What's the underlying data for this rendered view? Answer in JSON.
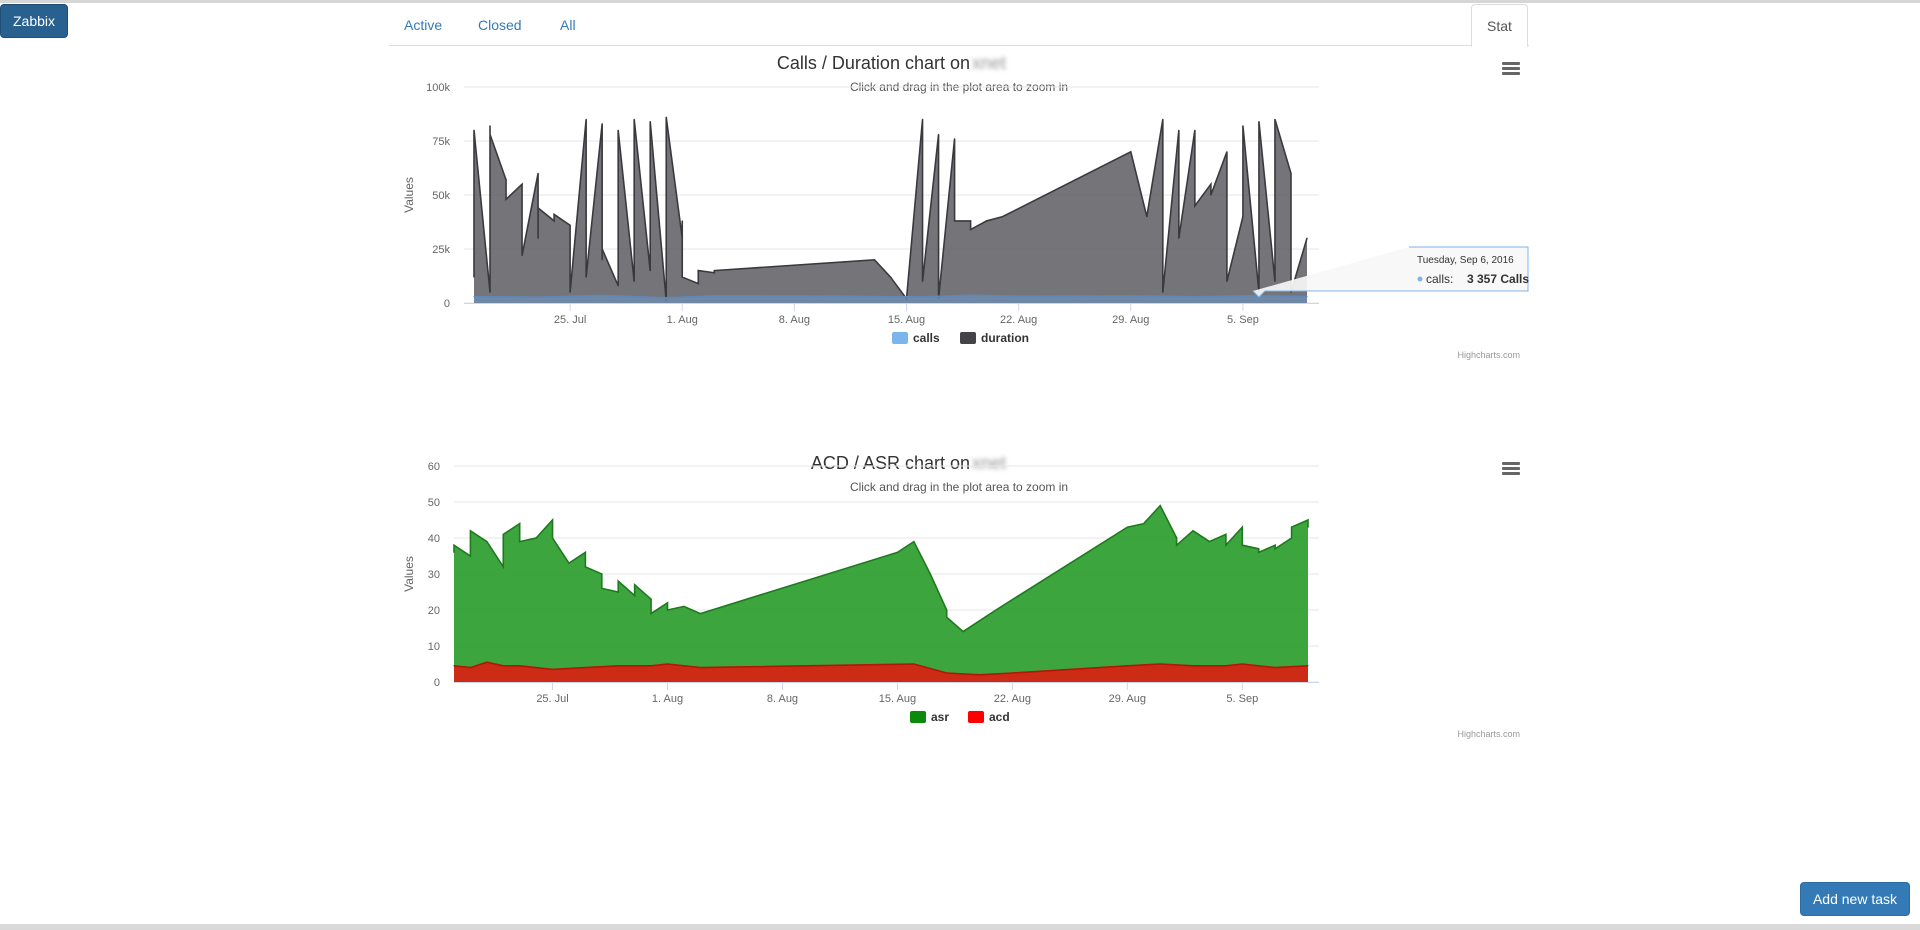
{
  "app": {
    "brand_label": "Zabbix",
    "add_task_label": "Add new task"
  },
  "tabs": [
    {
      "label": "Active",
      "active": false
    },
    {
      "label": "Closed",
      "active": false
    },
    {
      "label": "All",
      "active": false
    },
    {
      "label": "Stat",
      "active": true
    }
  ],
  "charts_meta": {
    "menu_icon": "hamburger-menu-icon",
    "credits": "Highcharts.com"
  },
  "chart_data": [
    {
      "type": "area",
      "title": "Calls / Duration chart on",
      "title_host": "xnet",
      "subtitle": "Click and drag in the plot area to zoom in",
      "ylabel": "Values",
      "ylim": [
        0,
        100000
      ],
      "y_ticks": [
        0,
        25000,
        50000,
        75000,
        100000
      ],
      "y_tick_labels": [
        "0",
        "25k",
        "50k",
        "75k",
        "100k"
      ],
      "x_range": [
        "2016-07-19",
        "2016-09-09"
      ],
      "x_ticks": [
        "2016-07-25",
        "2016-08-01",
        "2016-08-08",
        "2016-08-15",
        "2016-08-22",
        "2016-08-29",
        "2016-09-05"
      ],
      "x_tick_labels": [
        "25. Jul",
        "1. Aug",
        "8. Aug",
        "15. Aug",
        "22. Aug",
        "29. Aug",
        "5. Sep"
      ],
      "grid": true,
      "legend_position": "bottom-center",
      "series": [
        {
          "name": "duration",
          "color": "#434348",
          "x": [
            "2016-07-19",
            "2016-07-19",
            "2016-07-20",
            "2016-07-20",
            "2016-07-20",
            "2016-07-21",
            "2016-07-21",
            "2016-07-22",
            "2016-07-22",
            "2016-07-23",
            "2016-07-23",
            "2016-07-23",
            "2016-07-24",
            "2016-07-24",
            "2016-07-25",
            "2016-07-25",
            "2016-07-26",
            "2016-07-26",
            "2016-07-27",
            "2016-07-27",
            "2016-07-27",
            "2016-07-28",
            "2016-07-28",
            "2016-07-29",
            "2016-07-29",
            "2016-07-30",
            "2016-07-30",
            "2016-07-31",
            "2016-07-31",
            "2016-08-01",
            "2016-08-01",
            "2016-08-01",
            "2016-08-02",
            "2016-08-02",
            "2016-08-03",
            "2016-08-03",
            "2016-08-13",
            "2016-08-14",
            "2016-08-15",
            "2016-08-16",
            "2016-08-16",
            "2016-08-17",
            "2016-08-17",
            "2016-08-18",
            "2016-08-18",
            "2016-08-19",
            "2016-08-19",
            "2016-08-20",
            "2016-08-20",
            "2016-08-21",
            "2016-08-29",
            "2016-08-30",
            "2016-08-31",
            "2016-08-31",
            "2016-09-01",
            "2016-09-01",
            "2016-09-02",
            "2016-09-02",
            "2016-09-03",
            "2016-09-03",
            "2016-09-04",
            "2016-09-04",
            "2016-09-05",
            "2016-09-05",
            "2016-09-06",
            "2016-09-06",
            "2016-09-07",
            "2016-09-07",
            "2016-09-08",
            "2016-09-08",
            "2016-09-09"
          ],
          "values": [
            12000,
            80000,
            5000,
            82000,
            78000,
            57000,
            48000,
            55000,
            22000,
            60000,
            30000,
            44000,
            38000,
            41000,
            36000,
            5000,
            85000,
            12000,
            83000,
            20000,
            25000,
            8000,
            80000,
            10000,
            85000,
            15000,
            84000,
            1000,
            86000,
            30000,
            38000,
            12000,
            9000,
            15000,
            14000,
            15000,
            20000,
            12000,
            2000,
            85000,
            10000,
            78000,
            2000,
            76000,
            38000,
            38000,
            34000,
            38000,
            38000,
            40000,
            70000,
            40000,
            85000,
            5000,
            80000,
            30000,
            80000,
            45000,
            55000,
            50000,
            70000,
            10000,
            40000,
            82000,
            5000,
            84000,
            10000,
            85000,
            60000,
            5000,
            30000
          ]
        },
        {
          "name": "calls",
          "color": "#7cb5ec",
          "x": [
            "2016-07-19",
            "2016-07-23",
            "2016-07-27",
            "2016-07-31",
            "2016-08-03",
            "2016-08-10",
            "2016-08-16",
            "2016-08-19",
            "2016-08-22",
            "2016-08-29",
            "2016-09-02",
            "2016-09-06",
            "2016-09-09"
          ],
          "values": [
            3000,
            2700,
            3500,
            2400,
            3300,
            3200,
            2800,
            3600,
            3100,
            3300,
            2900,
            3357,
            3000
          ]
        }
      ],
      "tooltip": {
        "date": "Tuesday, Sep 6, 2016",
        "series": "calls:",
        "value": "3 357 Calls"
      }
    },
    {
      "type": "area",
      "title": "ACD / ASR chart on",
      "title_host": "xnet",
      "subtitle": "Click and drag in the plot area to zoom in",
      "ylabel": "Values",
      "ylim": [
        0,
        60
      ],
      "y_ticks": [
        0,
        10,
        20,
        30,
        40,
        50,
        60
      ],
      "y_tick_labels": [
        "0",
        "10",
        "20",
        "30",
        "40",
        "50",
        "60"
      ],
      "x_range": [
        "2016-07-19",
        "2016-09-09"
      ],
      "x_ticks": [
        "2016-07-25",
        "2016-08-01",
        "2016-08-08",
        "2016-08-15",
        "2016-08-22",
        "2016-08-29",
        "2016-09-05"
      ],
      "x_tick_labels": [
        "25. Jul",
        "1. Aug",
        "8. Aug",
        "15. Aug",
        "22. Aug",
        "29. Aug",
        "5. Sep"
      ],
      "grid": true,
      "legend_position": "bottom-center",
      "series": [
        {
          "name": "asr",
          "color": "#2f9a2f",
          "x": [
            "2016-07-19",
            "2016-07-19",
            "2016-07-20",
            "2016-07-20",
            "2016-07-21",
            "2016-07-22",
            "2016-07-22",
            "2016-07-23",
            "2016-07-23",
            "2016-07-24",
            "2016-07-25",
            "2016-07-25",
            "2016-07-26",
            "2016-07-27",
            "2016-07-27",
            "2016-07-28",
            "2016-07-28",
            "2016-07-29",
            "2016-07-29",
            "2016-07-30",
            "2016-07-30",
            "2016-07-31",
            "2016-07-31",
            "2016-08-01",
            "2016-08-01",
            "2016-08-02",
            "2016-08-03",
            "2016-08-15",
            "2016-08-16",
            "2016-08-17",
            "2016-08-18",
            "2016-08-18",
            "2016-08-19",
            "2016-08-20",
            "2016-08-21",
            "2016-08-29",
            "2016-08-30",
            "2016-08-31",
            "2016-09-01",
            "2016-09-01",
            "2016-09-02",
            "2016-09-03",
            "2016-09-04",
            "2016-09-04",
            "2016-09-05",
            "2016-09-05",
            "2016-09-06",
            "2016-09-06",
            "2016-09-07",
            "2016-09-07",
            "2016-09-08",
            "2016-09-08",
            "2016-09-09",
            "2016-09-09"
          ],
          "values": [
            36,
            38,
            35,
            42,
            39,
            32,
            41,
            44,
            39,
            40,
            45,
            40,
            33,
            36,
            32,
            30,
            26,
            25,
            28,
            24,
            27,
            23,
            19,
            22,
            20,
            21,
            19,
            36,
            39,
            30,
            20,
            18,
            14,
            17,
            20,
            43,
            44,
            49,
            40,
            38,
            42,
            39,
            41,
            38,
            43,
            38,
            37,
            36,
            38,
            37,
            40,
            43,
            45,
            43
          ]
        },
        {
          "name": "acd",
          "color": "#e21c0a",
          "x": [
            "2016-07-19",
            "2016-07-20",
            "2016-07-21",
            "2016-07-22",
            "2016-07-23",
            "2016-07-25",
            "2016-07-27",
            "2016-07-29",
            "2016-07-31",
            "2016-08-01",
            "2016-08-02",
            "2016-08-03",
            "2016-08-16",
            "2016-08-18",
            "2016-08-20",
            "2016-08-22",
            "2016-08-29",
            "2016-08-31",
            "2016-09-02",
            "2016-09-04",
            "2016-09-05",
            "2016-09-07",
            "2016-09-09"
          ],
          "values": [
            4.5,
            4,
            5.5,
            4.5,
            4.5,
            3.5,
            4,
            4.5,
            4.5,
            5,
            4.5,
            4,
            5,
            2.5,
            2,
            2.5,
            4.5,
            5,
            4.5,
            4.5,
            5,
            4,
            4.5
          ]
        }
      ]
    }
  ]
}
